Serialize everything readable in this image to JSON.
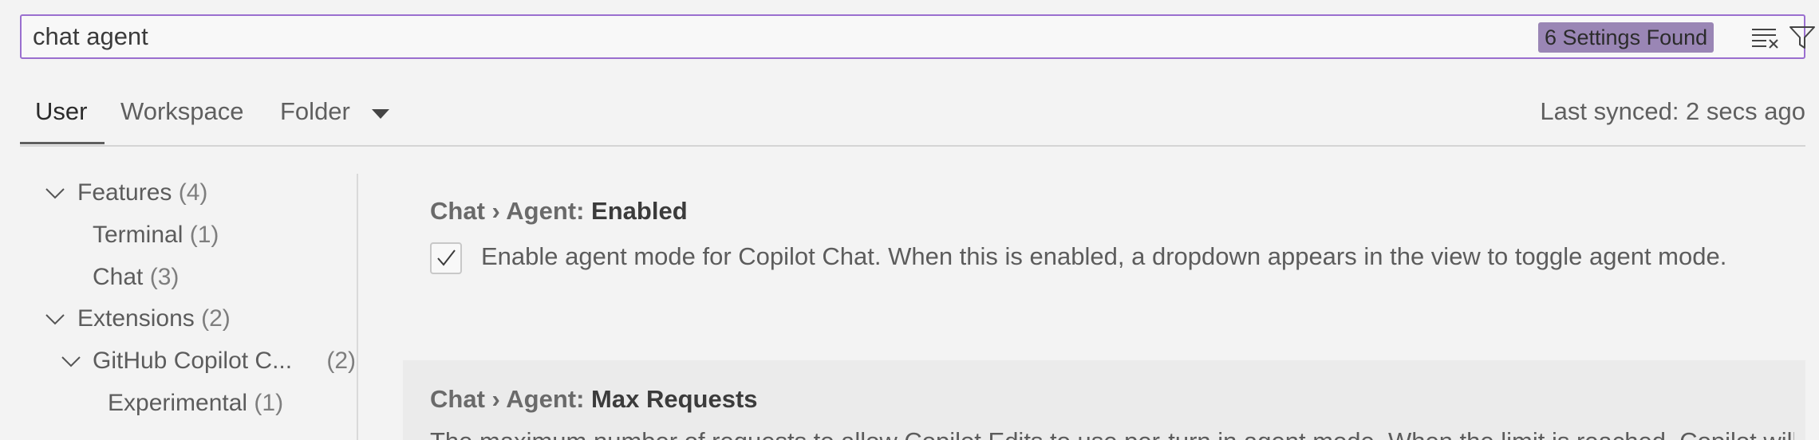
{
  "search": {
    "value": "chat agent",
    "result_count": "6 Settings Found",
    "clear_icon": "clear-filter-icon",
    "filter_icon": "filter-icon"
  },
  "tabs": {
    "user": "User",
    "workspace": "Workspace",
    "folder": "Folder",
    "sync_status": "Last synced: 2 secs ago"
  },
  "tree": {
    "features": {
      "label": "Features",
      "count": "(4)"
    },
    "terminal": {
      "label": "Terminal",
      "count": "(1)"
    },
    "chat": {
      "label": "Chat",
      "count": "(3)"
    },
    "extensions": {
      "label": "Extensions",
      "count": "(2)"
    },
    "copilot": {
      "label": "GitHub Copilot C...",
      "count": "(2)"
    },
    "experimental": {
      "label": "Experimental",
      "count": "(1)"
    }
  },
  "settings": [
    {
      "category": "Chat › Agent: ",
      "name": "Enabled",
      "checked": true,
      "description": "Enable agent mode for Copilot Chat. When this is enabled, a dropdown appears in the view to toggle agent mode."
    },
    {
      "category": "Chat › Agent: ",
      "name": "Max Requests",
      "description": "The maximum number of requests to allow Copilot Edits to use per-turn in agent mode. When the limit is reached, Copilot will ask"
    }
  ],
  "colors": {
    "accent": "#9a6fcf",
    "badge": "#9a86b5",
    "background": "#f3f3f3"
  }
}
